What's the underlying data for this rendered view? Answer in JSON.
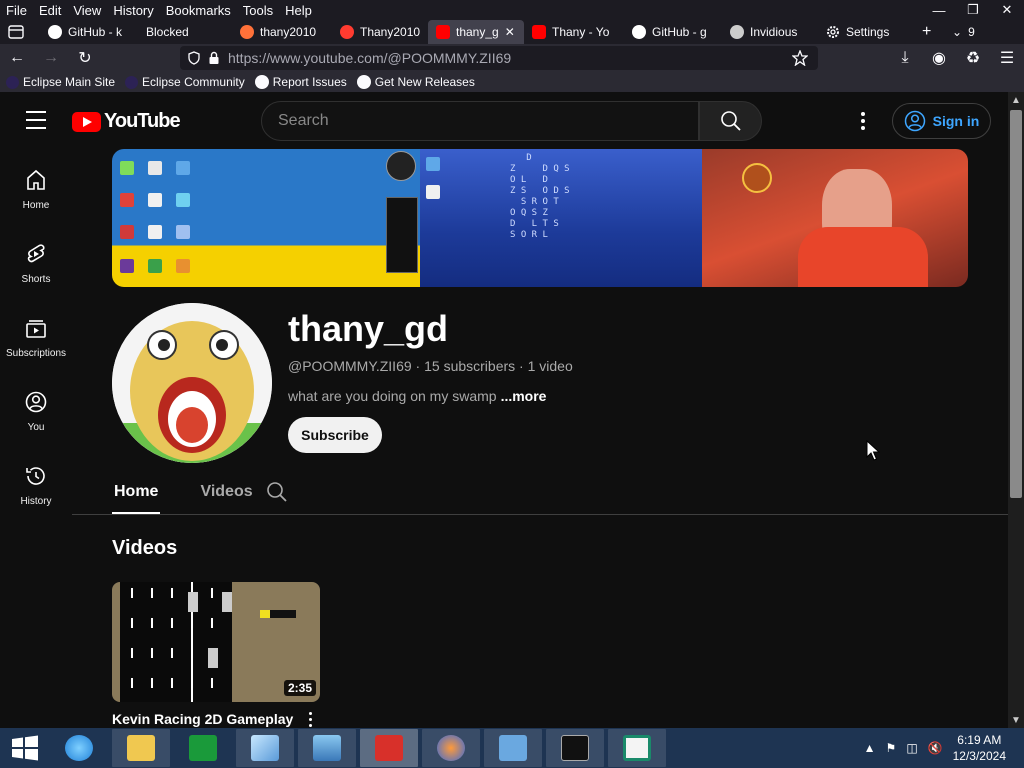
{
  "browser": {
    "menu": [
      "File",
      "Edit",
      "View",
      "History",
      "Bookmarks",
      "Tools",
      "Help"
    ],
    "tabs": [
      {
        "label": "GitHub - k",
        "color": "#ffffff"
      },
      {
        "label": "Blocked",
        "color": ""
      },
      {
        "label": "thany2010",
        "color": "#ff7139"
      },
      {
        "label": "Thany2010",
        "color": "#ff3b30"
      },
      {
        "label": "thany_g",
        "color": "#ff0000"
      },
      {
        "label": "Thany - Yo",
        "color": "#ff0000"
      },
      {
        "label": "GitHub - g",
        "color": "#ffffff"
      },
      {
        "label": "Invidious",
        "color": "#cccccc"
      },
      {
        "label": "Settings",
        "color": "#cccccc"
      }
    ],
    "tab_count": "9",
    "url": "https://www.youtube.com/@POOMMMY.ZII69",
    "bookmarks": [
      "Eclipse Main Site",
      "Eclipse Community",
      "Report Issues",
      "Get New Releases"
    ]
  },
  "youtube": {
    "logo_text": "YouTube",
    "search_placeholder": "Search",
    "signin_label": "Sign in",
    "sidebar": [
      {
        "label": "Home",
        "icon": "home-icon"
      },
      {
        "label": "Shorts",
        "icon": "shorts-icon"
      },
      {
        "label": "Subscriptions",
        "icon": "subscriptions-icon"
      },
      {
        "label": "You",
        "icon": "you-icon"
      },
      {
        "label": "History",
        "icon": "history-icon"
      }
    ],
    "channel": {
      "name": "thany_gd",
      "handle": "@POOMMMY.ZII69",
      "subscribers": "15 subscribers",
      "videos": "1 video",
      "description": "what are you doing on my swamp",
      "more_label": "...more",
      "subscribe_label": "Subscribe"
    },
    "tabs": [
      {
        "label": "Home",
        "active": true
      },
      {
        "label": "Videos",
        "active": false
      }
    ],
    "section_title": "Videos",
    "video": {
      "title": "Kevin Racing 2D Gameplay",
      "duration": "2:35"
    }
  },
  "taskbar": {
    "apps": [
      "internet-explorer",
      "file-explorer",
      "store",
      "notepad",
      "paint",
      "adobe-reader",
      "firefox",
      "control-panel",
      "command-prompt",
      "publisher"
    ],
    "time": "6:19 AM",
    "date": "12/3/2024"
  }
}
